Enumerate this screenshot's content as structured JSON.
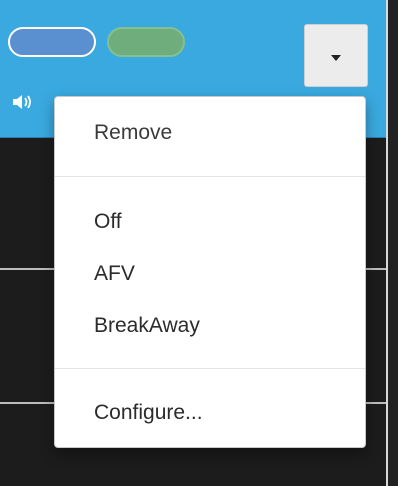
{
  "toolbar": {
    "pills": [
      {
        "name": "blue",
        "color": "#5a8fd0"
      },
      {
        "name": "green",
        "color": "#6fae7c"
      }
    ],
    "dropdown_icon": "caret-down-icon",
    "speaker_icon": "speaker-volume-icon"
  },
  "menu": {
    "items": [
      {
        "label": "Remove"
      },
      {
        "label": "Off"
      },
      {
        "label": "AFV"
      },
      {
        "label": "BreakAway"
      },
      {
        "label": "Configure..."
      }
    ]
  },
  "colors": {
    "header": "#3aa9df",
    "background": "#1c1c1c",
    "menu_bg": "#ffffff"
  }
}
